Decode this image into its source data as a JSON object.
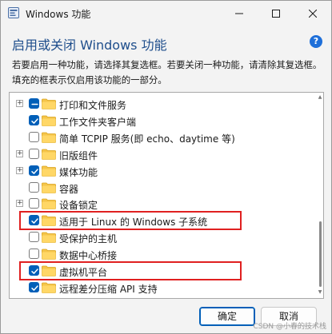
{
  "window": {
    "title": "Windows 功能",
    "heading": "启用或关闭 Windows 功能",
    "help_label": "?",
    "description": "若要启用一种功能，请选择其复选框。若要关闭一种功能，请清除其复选框。填充的框表示仅启用该功能的一部分。"
  },
  "features": [
    {
      "label": "打印和文件服务",
      "state": "partial",
      "expandable": true,
      "highlighted": false
    },
    {
      "label": "工作文件夹客户端",
      "state": "checked",
      "expandable": false,
      "highlighted": false
    },
    {
      "label": "简单 TCPIP 服务(即 echo、daytime 等)",
      "state": "unchecked",
      "expandable": false,
      "highlighted": false
    },
    {
      "label": "旧版组件",
      "state": "unchecked",
      "expandable": true,
      "highlighted": false
    },
    {
      "label": "媒体功能",
      "state": "checked",
      "expandable": true,
      "highlighted": false
    },
    {
      "label": "容器",
      "state": "unchecked",
      "expandable": false,
      "highlighted": false
    },
    {
      "label": "设备锁定",
      "state": "unchecked",
      "expandable": true,
      "highlighted": false
    },
    {
      "label": "适用于 Linux 的 Windows 子系统",
      "state": "checked",
      "expandable": false,
      "highlighted": true
    },
    {
      "label": "受保护的主机",
      "state": "unchecked",
      "expandable": false,
      "highlighted": false
    },
    {
      "label": "数据中心桥接",
      "state": "unchecked",
      "expandable": false,
      "highlighted": false
    },
    {
      "label": "虚拟机平台",
      "state": "checked",
      "expandable": false,
      "highlighted": true
    },
    {
      "label": "远程差分压缩 API 支持",
      "state": "checked",
      "expandable": false,
      "highlighted": false
    }
  ],
  "buttons": {
    "ok": "确定",
    "cancel": "取消"
  },
  "watermark": "CSDN @小春的技术栈",
  "colors": {
    "accent": "#005fb8",
    "folder": "#f5c54a",
    "highlight": "#e02020",
    "heading": "#1f4e8c"
  }
}
